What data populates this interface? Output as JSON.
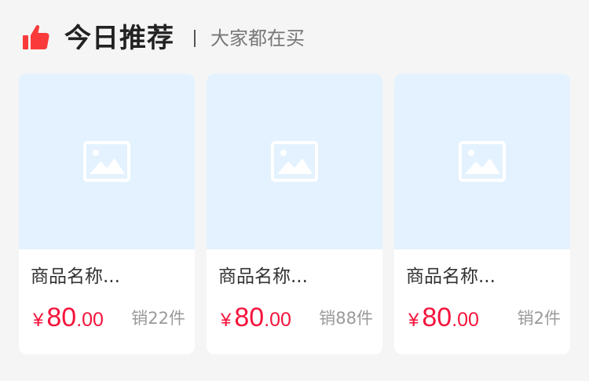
{
  "header": {
    "icon": "thumbs-up-icon",
    "title": "今日推荐",
    "subtitle": "大家都在买"
  },
  "colors": {
    "accent": "#f5143c",
    "image_bg": "#e3f2fe",
    "page_bg": "#f5f5f5",
    "card_bg": "#ffffff"
  },
  "products": [
    {
      "name": "商品名称...",
      "price_symbol": "¥",
      "price_int": "80",
      "price_dec": ".00",
      "sales": "销22件",
      "image_icon": "image-placeholder-icon"
    },
    {
      "name": "商品名称...",
      "price_symbol": "¥",
      "price_int": "80",
      "price_dec": ".00",
      "sales": "销88件",
      "image_icon": "image-placeholder-icon"
    },
    {
      "name": "商品名称...",
      "price_symbol": "¥",
      "price_int": "80",
      "price_dec": ".00",
      "sales": "销2件",
      "image_icon": "image-placeholder-icon"
    }
  ]
}
